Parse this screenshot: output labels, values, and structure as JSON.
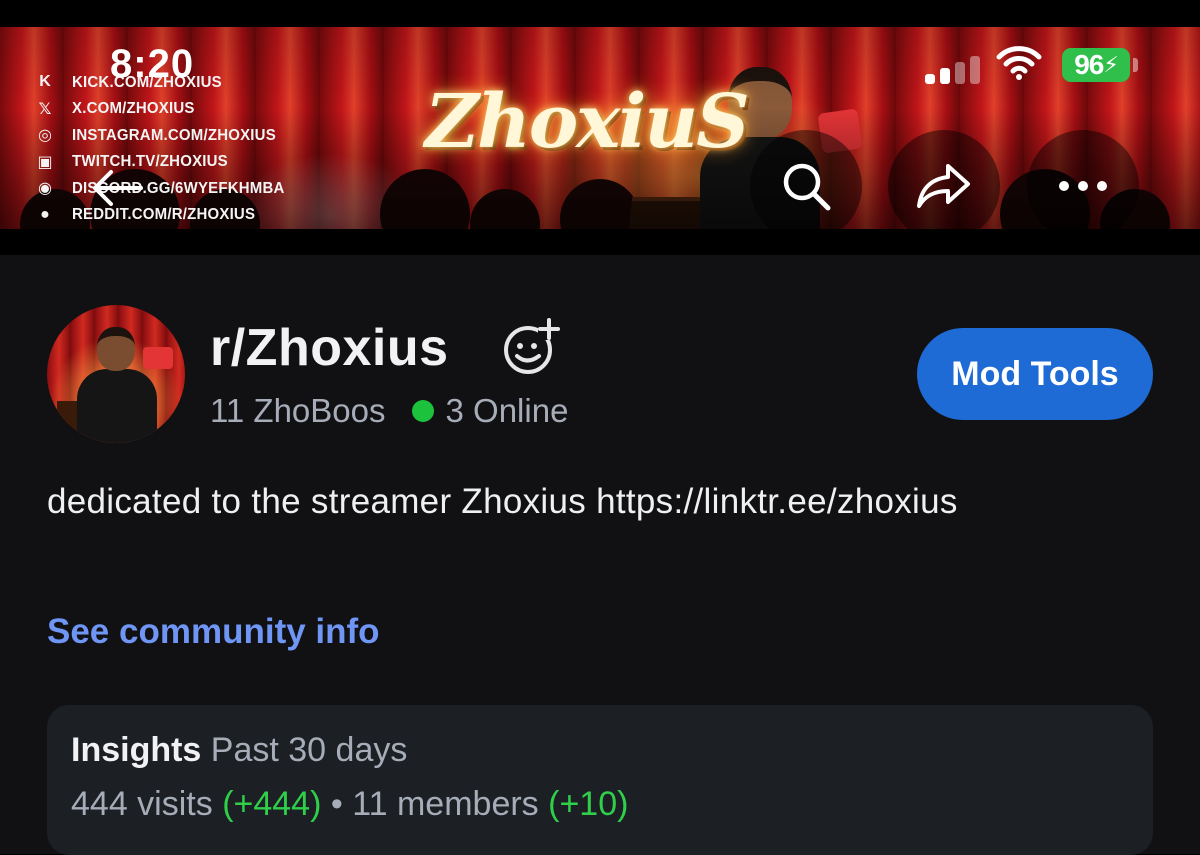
{
  "status_bar": {
    "time": "8:20",
    "battery": "96"
  },
  "banner": {
    "logo_text": "ZhoxiuS",
    "socials": [
      {
        "icon": "kick-icon",
        "glyph": "K",
        "text": "KICK.COM/ZHOXIUS"
      },
      {
        "icon": "x-icon",
        "glyph": "𝕏",
        "text": "X.COM/ZHOXIUS"
      },
      {
        "icon": "instagram-icon",
        "glyph": "◎",
        "text": "INSTAGRAM.COM/ZHOXIUS"
      },
      {
        "icon": "twitch-icon",
        "glyph": "▣",
        "text": "TWITCH.TV/ZHOXIUS"
      },
      {
        "icon": "discord-icon",
        "glyph": "◉",
        "text": "DISCORD.GG/6WYEFKHMBA"
      },
      {
        "icon": "reddit-icon",
        "glyph": "●",
        "text": "REDDIT.COM/R/ZHOXIUS"
      }
    ]
  },
  "community": {
    "name": "r/Zhoxius",
    "members": "11 ZhoBoos",
    "online": "3 Online",
    "mod_tools_label": "Mod Tools",
    "description": "dedicated to the streamer Zhoxius https://linktr.ee/zhoxius",
    "see_info_label": "See community info"
  },
  "insights": {
    "title": "Insights",
    "period": "Past 30 days",
    "visits": "444 visits",
    "visits_delta": "(+444)",
    "separator": "•",
    "members": "11 members",
    "members_delta": "(+10)"
  },
  "colors": {
    "accent": "#1e6bd6",
    "link": "#6f95f5",
    "online": "#1cc23b",
    "positive": "#2fcf4a"
  }
}
